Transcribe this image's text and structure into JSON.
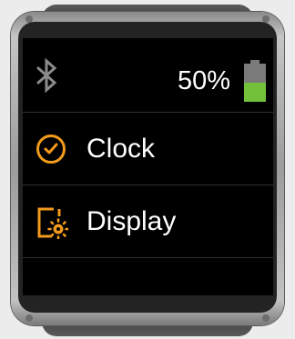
{
  "status": {
    "battery_text": "50%",
    "battery_level": 0.5,
    "battery_color": "#73c13b",
    "icons": [
      "bluetooth-icon",
      "battery-icon"
    ]
  },
  "menu": {
    "items": [
      {
        "label": "Clock",
        "icon": "clock-icon"
      },
      {
        "label": "Display",
        "icon": "display-settings-icon"
      }
    ],
    "accent_color": "#f29a1c"
  },
  "colors": {
    "screen": "#000000",
    "text": "#ffffff",
    "bezel": "#a6a6a6",
    "strap": "#454545",
    "background": "#ececec"
  }
}
